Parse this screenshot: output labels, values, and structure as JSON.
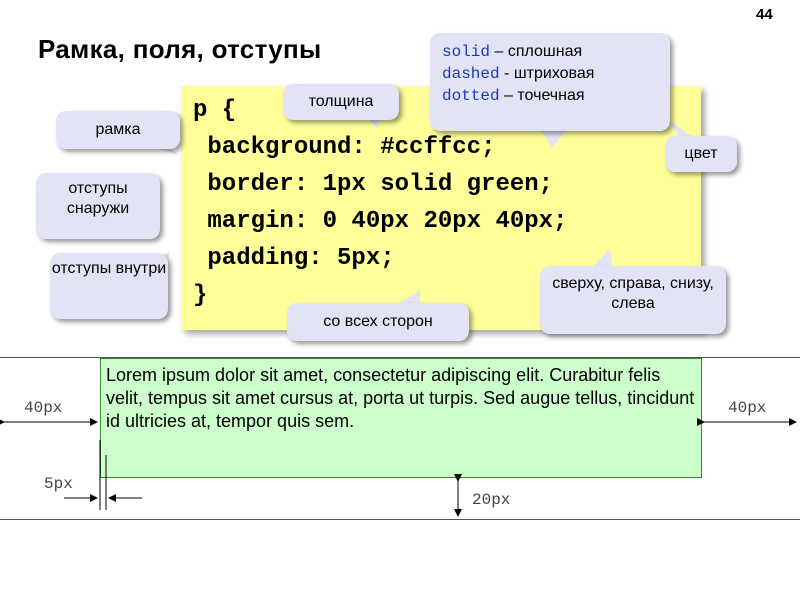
{
  "page_number": "44",
  "title": "Рамка, поля, отступы",
  "code": {
    "lines": [
      "p {",
      " background: #ccffcc;",
      " border: 1px solid green;",
      " margin: 0 40px 20px 40px;",
      " padding: 5px;",
      "}"
    ]
  },
  "callouts": {
    "frame": "рамка",
    "outer_margin": "отступы снаружи",
    "inner_padding": "отступы внутри",
    "thickness": "толщина",
    "color": "цвет",
    "all_sides": "со всех сторон",
    "clockwise": "сверху, справа, снизу, слева",
    "styles": [
      {
        "keyword": "solid",
        "sep": " – ",
        "text": "сплошная"
      },
      {
        "keyword": "dashed",
        "sep": " - ",
        "text": "штриховая"
      },
      {
        "keyword": "dotted",
        "sep": " – ",
        "text": "точечная"
      }
    ]
  },
  "demo": {
    "text": "Lorem ipsum dolor sit amet, consectetur adipiscing elit. Curabitur felis velit, tempus sit amet cursus at, porta ut turpis. Sed augue tellus, tincidunt id ultricies at, tempor quis sem.",
    "margin_left_label": "40px",
    "margin_right_label": "40px",
    "padding_label": "5px",
    "margin_bottom_label": "20px"
  },
  "colors": {
    "code_bg": "#ffff99",
    "bubble_bg": "#e3e3f6",
    "keyword": "#1a3bb4",
    "demo_bg": "#ccffcc",
    "demo_border": "#2e8b2e"
  }
}
